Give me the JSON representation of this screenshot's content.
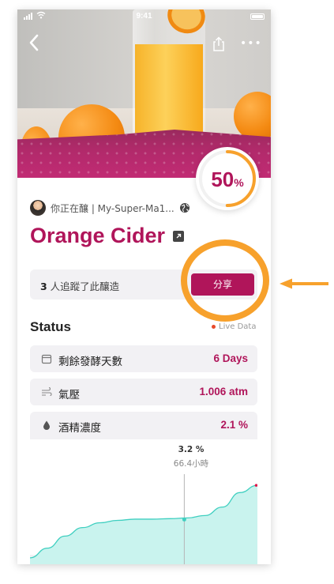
{
  "status_bar": {
    "time": "9:41"
  },
  "hero": {
    "progress_percent": 50,
    "progress_number": "50",
    "progress_unit": "%"
  },
  "brewer": {
    "text": "你正在釀 | My-Super-Ma1..."
  },
  "title": "Orange Cider",
  "follow": {
    "count": "3",
    "suffix": " 人追蹤了此釀造",
    "share_label": "分享"
  },
  "status_section": {
    "title": "Status",
    "live_label": "Live Data"
  },
  "stats": [
    {
      "icon": "calendar-icon",
      "label": "剩餘發酵天數",
      "value": "6 Days"
    },
    {
      "icon": "wind-icon",
      "label": "氣壓",
      "value": "1.006 atm"
    },
    {
      "icon": "drop-icon",
      "label": "酒精濃度",
      "value": "2.1 %"
    }
  ],
  "chart_data": {
    "type": "area",
    "title": "",
    "xlabel": "",
    "ylabel": "",
    "grid": false,
    "series": [
      {
        "values": [
          0.2,
          0.6,
          1.1,
          1.45,
          1.65,
          1.75,
          1.8,
          1.8,
          1.82,
          1.85,
          1.95,
          2.3,
          2.9,
          3.2
        ]
      }
    ],
    "tooltip": {
      "value": "3.2 %",
      "time": "66.4小時"
    },
    "colors": {
      "fill": "#c9f3ee",
      "line": "#3fcfc0",
      "marker": "#e0184a"
    }
  },
  "colors": {
    "accent": "#b0155a",
    "annotation": "#f7a12c"
  }
}
